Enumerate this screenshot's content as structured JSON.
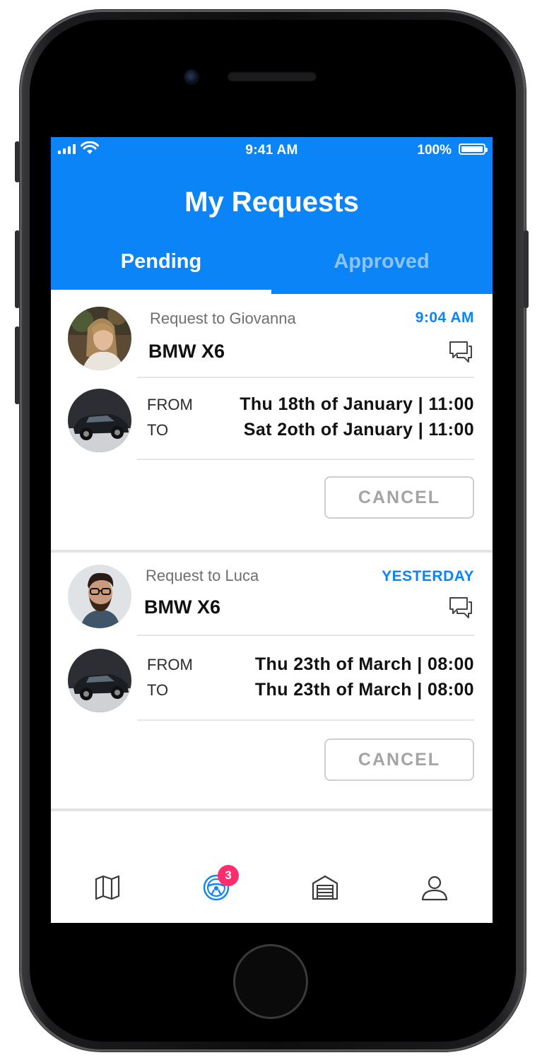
{
  "status_bar": {
    "time": "9:41 AM",
    "battery": "100%"
  },
  "header": {
    "title": "My Requests",
    "tabs": [
      {
        "label": "Pending",
        "active": true
      },
      {
        "label": "Approved",
        "active": false
      }
    ]
  },
  "requests": [
    {
      "request_to": "Request to Giovanna",
      "time": "9:04 AM",
      "car": "BMW X6",
      "from_label": "FROM",
      "to_label": "TO",
      "from": "Thu 18th of January | 11:00",
      "to": "Sat 2oth of January | 11:00",
      "cancel": "CANCEL"
    },
    {
      "request_to": "Request to Luca",
      "time": "YESTERDAY",
      "car": "BMW X6",
      "from_label": "FROM",
      "to_label": "TO",
      "from": "Thu 23th of March | 08:00",
      "to": "Thu 23th of March | 08:00",
      "cancel": "CANCEL"
    }
  ],
  "tab_bar": {
    "items": [
      {
        "icon": "map-icon",
        "active": false
      },
      {
        "icon": "steering-wheel-icon",
        "active": true,
        "badge": "3"
      },
      {
        "icon": "garage-icon",
        "active": false
      },
      {
        "icon": "user-icon",
        "active": false
      }
    ]
  },
  "colors": {
    "accent": "#0b84f7",
    "badge": "#ff2d6e",
    "muted_tab": "#8cc3fa"
  }
}
